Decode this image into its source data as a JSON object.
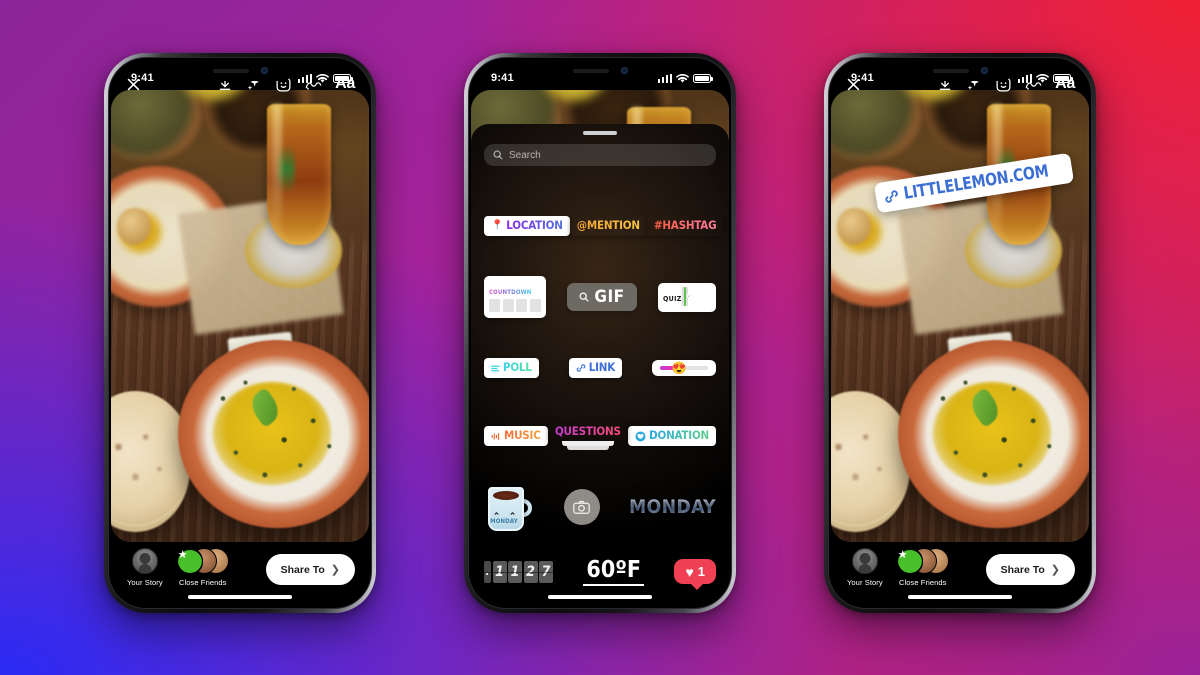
{
  "background": {
    "gradient_colors": [
      "#8b249a",
      "#ef2033",
      "#2b2bf5",
      "#9a2299"
    ]
  },
  "phones": [
    {
      "id": "phone-story-editor",
      "status_bar": {
        "time": "9:41"
      },
      "toolbar": {
        "close_label": "✕",
        "icons": [
          "close-icon",
          "download-icon",
          "sparkles-icon",
          "sticker-icon",
          "draw-icon",
          "text-icon"
        ],
        "text_icon_label": "Aa"
      },
      "story_bar": {
        "your_story_label": "Your Story",
        "close_friends_label": "Close Friends",
        "share_label": "Share To",
        "share_chevron": "❯"
      }
    },
    {
      "id": "phone-sticker-tray",
      "status_bar": {
        "time": "9:41"
      },
      "search": {
        "placeholder": "Search",
        "value": ""
      },
      "stickers": {
        "row1": [
          {
            "name": "location",
            "label": "LOCATION",
            "icon": "location-pin-icon"
          },
          {
            "name": "mention",
            "label": "@MENTION"
          },
          {
            "name": "hashtag",
            "label": "#HASHTAG"
          }
        ],
        "row2": [
          {
            "name": "countdown",
            "label": "COUNTDOWN",
            "digits": [
              "",
              "",
              "",
              ""
            ]
          },
          {
            "name": "gif",
            "label": "GIF",
            "icon": "search-icon"
          },
          {
            "name": "quiz",
            "label": "QUIZ",
            "options": [
              "",
              "",
              ""
            ],
            "selected_index": 1
          }
        ],
        "row3": [
          {
            "name": "poll",
            "label": "POLL",
            "icon": "poll-bars-icon"
          },
          {
            "name": "link",
            "label": "LINK",
            "icon": "link-chain-icon"
          },
          {
            "name": "emoji-slider",
            "label": "",
            "emoji": "😍",
            "fill_percent": 46
          }
        ],
        "row4": [
          {
            "name": "music",
            "label": "MUSIC",
            "icon": "music-wave-icon"
          },
          {
            "name": "questions",
            "label": "QUESTIONS"
          },
          {
            "name": "donation",
            "label": "DONATION",
            "icon": "heart-circle-icon"
          }
        ],
        "row5": [
          {
            "name": "coffee-mug",
            "label": "MONDAY"
          },
          {
            "name": "camera",
            "label": "",
            "icon": "camera-icon"
          },
          {
            "name": "monday-text",
            "label": "MONDAY"
          }
        ],
        "row6": [
          {
            "name": "time-clock",
            "label": "11:27",
            "digits": [
              ".",
              "1",
              "1",
              "2",
              "7"
            ]
          },
          {
            "name": "temperature",
            "label": "60ºF"
          },
          {
            "name": "like-count",
            "label": "1",
            "icon": "heart-icon"
          }
        ]
      }
    },
    {
      "id": "phone-story-with-link",
      "status_bar": {
        "time": "9:41"
      },
      "toolbar": {
        "close_label": "✕",
        "icons": [
          "close-icon",
          "download-icon",
          "sparkles-icon",
          "sticker-icon",
          "draw-icon",
          "text-icon"
        ],
        "text_icon_label": "Aa"
      },
      "link_sticker": {
        "label": "LITTLELEMON.COM",
        "icon": "link-chain-icon",
        "color": "#3b6fd4"
      },
      "story_bar": {
        "your_story_label": "Your Story",
        "close_friends_label": "Close Friends",
        "share_label": "Share To",
        "share_chevron": "❯"
      }
    }
  ]
}
